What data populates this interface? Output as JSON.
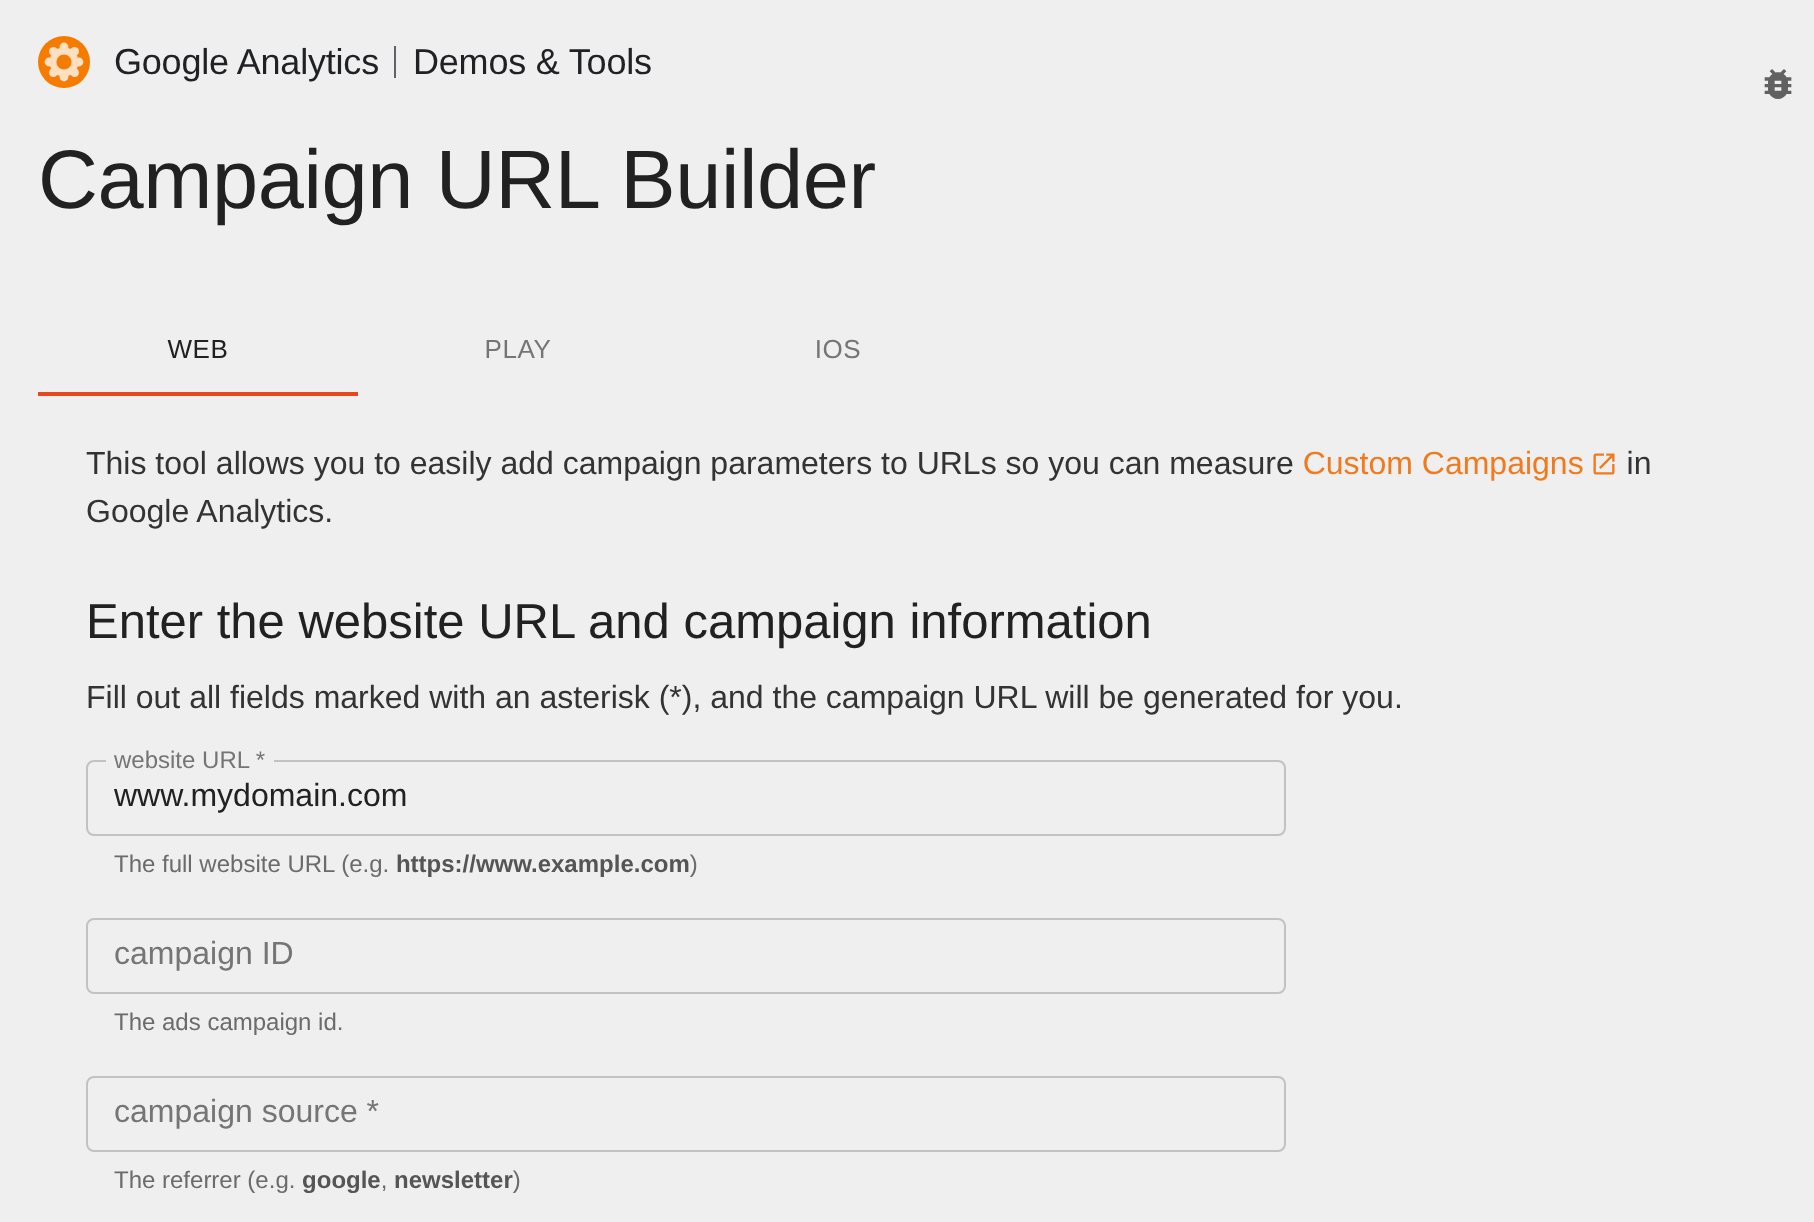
{
  "header": {
    "brand": "Google Analytics",
    "section": "Demos & Tools"
  },
  "title": "Campaign URL Builder",
  "tabs": [
    {
      "label": "WEB",
      "selected": true
    },
    {
      "label": "PLAY",
      "selected": false
    },
    {
      "label": "IOS",
      "selected": false
    }
  ],
  "intro": {
    "text_before": "This tool allows you to easily add campaign parameters to URLs so you can measure",
    "link": "Custom Campaigns",
    "text_after": "in Google Analytics."
  },
  "form": {
    "heading": "Enter the website URL and campaign information",
    "instructions": "Fill out all fields marked with an asterisk (*), and the campaign URL will be generated for you.",
    "fields": [
      {
        "label": "website URL *",
        "value": "www.mydomain.com",
        "helper": "The full website URL (e.g. **https://www.example.com**)"
      },
      {
        "placeholder": "campaign ID",
        "helper": "The ads campaign id."
      },
      {
        "placeholder": "campaign source *",
        "helper": "The referrer (e.g. **google**, **newsletter**)"
      }
    ]
  }
}
